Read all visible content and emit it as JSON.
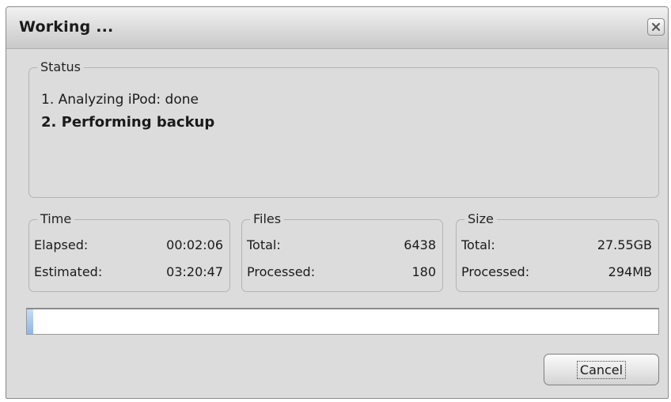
{
  "window": {
    "title": "Working ..."
  },
  "icons": {
    "close": "close-icon"
  },
  "status": {
    "legend": "Status",
    "lines": [
      "1. Analyzing iPod: done",
      "2. Performing backup"
    ]
  },
  "time": {
    "legend": "Time",
    "elapsed_label": "Elapsed:",
    "elapsed_value": "00:02:06",
    "estimated_label": "Estimated:",
    "estimated_value": "03:20:47"
  },
  "files": {
    "legend": "Files",
    "total_label": "Total:",
    "total_value": "6438",
    "processed_label": "Processed:",
    "processed_value": "180"
  },
  "size": {
    "legend": "Size",
    "total_label": "Total:",
    "total_value": "27.55GB",
    "processed_label": "Processed:",
    "processed_value": "294MB"
  },
  "progress": {
    "fraction": 0.01
  },
  "buttons": {
    "cancel_label": "Cancel"
  },
  "colors": {
    "progress_fill": "#8db6e6",
    "dialog_bg": "#dcdcdc"
  }
}
